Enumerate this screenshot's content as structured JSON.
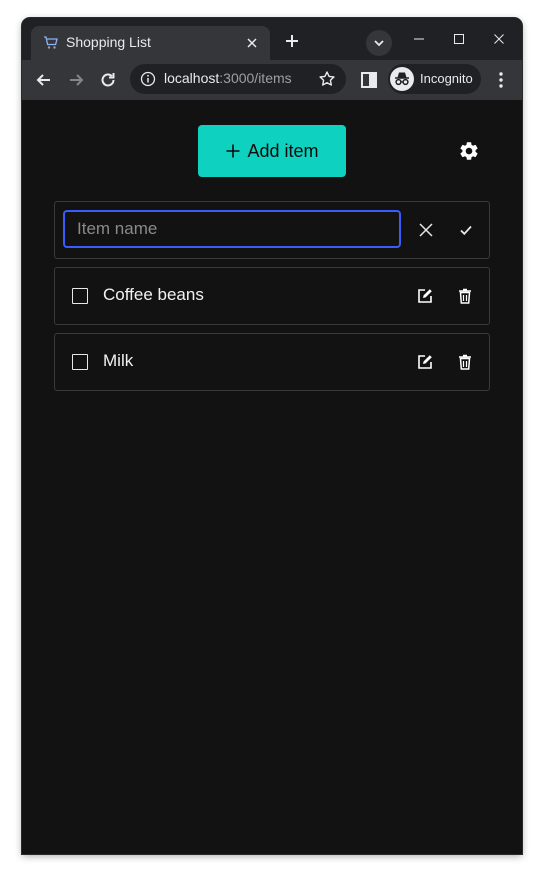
{
  "browser": {
    "tab_title": "Shopping List",
    "url_host": "localhost",
    "url_path": ":3000/items",
    "profile_label": "Incognito"
  },
  "app": {
    "add_item_label": "Add item",
    "new_item": {
      "placeholder": "Item name",
      "value": ""
    },
    "items": [
      {
        "label": "Coffee beans",
        "checked": false
      },
      {
        "label": "Milk",
        "checked": false
      }
    ]
  },
  "colors": {
    "accent": "#0fd1c0",
    "input_focus": "#3b5bfd",
    "background": "#121212"
  }
}
